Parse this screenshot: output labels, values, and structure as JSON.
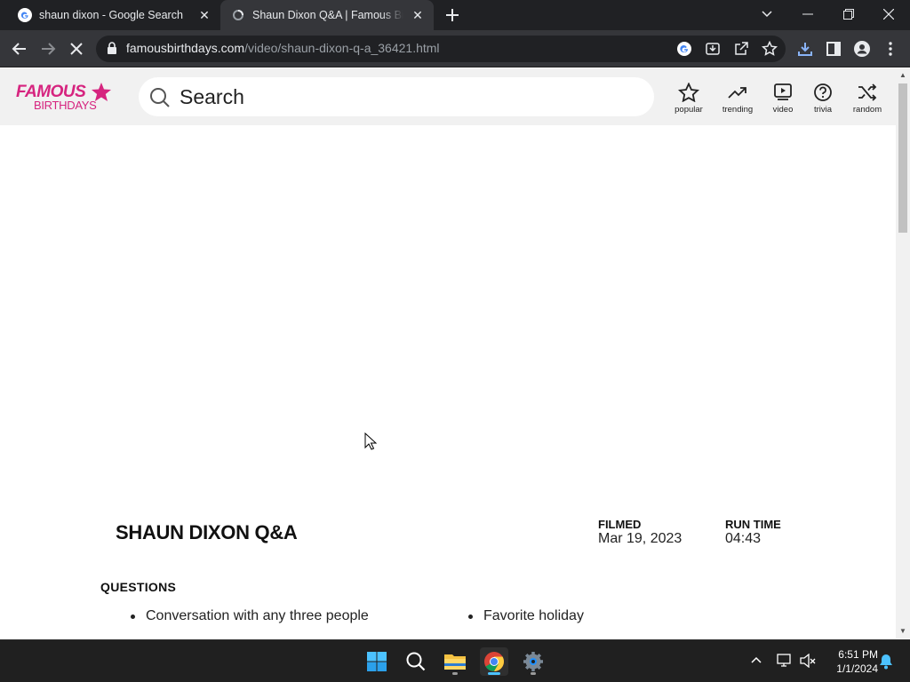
{
  "browser": {
    "tabs": [
      {
        "title": "shaun dixon - Google Search",
        "active": false
      },
      {
        "title": "Shaun Dixon Q&A | Famous Birthdays",
        "active": true
      }
    ],
    "url_domain": "famousbirthdays.com",
    "url_path": "/video/shaun-dixon-q-a_36421.html"
  },
  "site": {
    "logo_top": "FAMOUS",
    "logo_bottom": "BIRTHDAYS",
    "brand_color": "#d6247f",
    "search_placeholder": "Search",
    "nav": [
      {
        "label": "popular",
        "icon": "star-icon"
      },
      {
        "label": "trending",
        "icon": "trending-icon"
      },
      {
        "label": "video",
        "icon": "video-icon"
      },
      {
        "label": "trivia",
        "icon": "question-icon"
      },
      {
        "label": "random",
        "icon": "shuffle-icon"
      }
    ]
  },
  "video": {
    "title": "SHAUN DIXON Q&A",
    "filmed_label": "FILMED",
    "filmed_value": "Mar 19, 2023",
    "runtime_label": "RUN TIME",
    "runtime_value": "04:43",
    "questions_label": "QUESTIONS",
    "questions": [
      "Conversation with any three people",
      "Favorite holiday"
    ]
  },
  "taskbar": {
    "time": "6:51 PM",
    "date": "1/1/2024"
  }
}
